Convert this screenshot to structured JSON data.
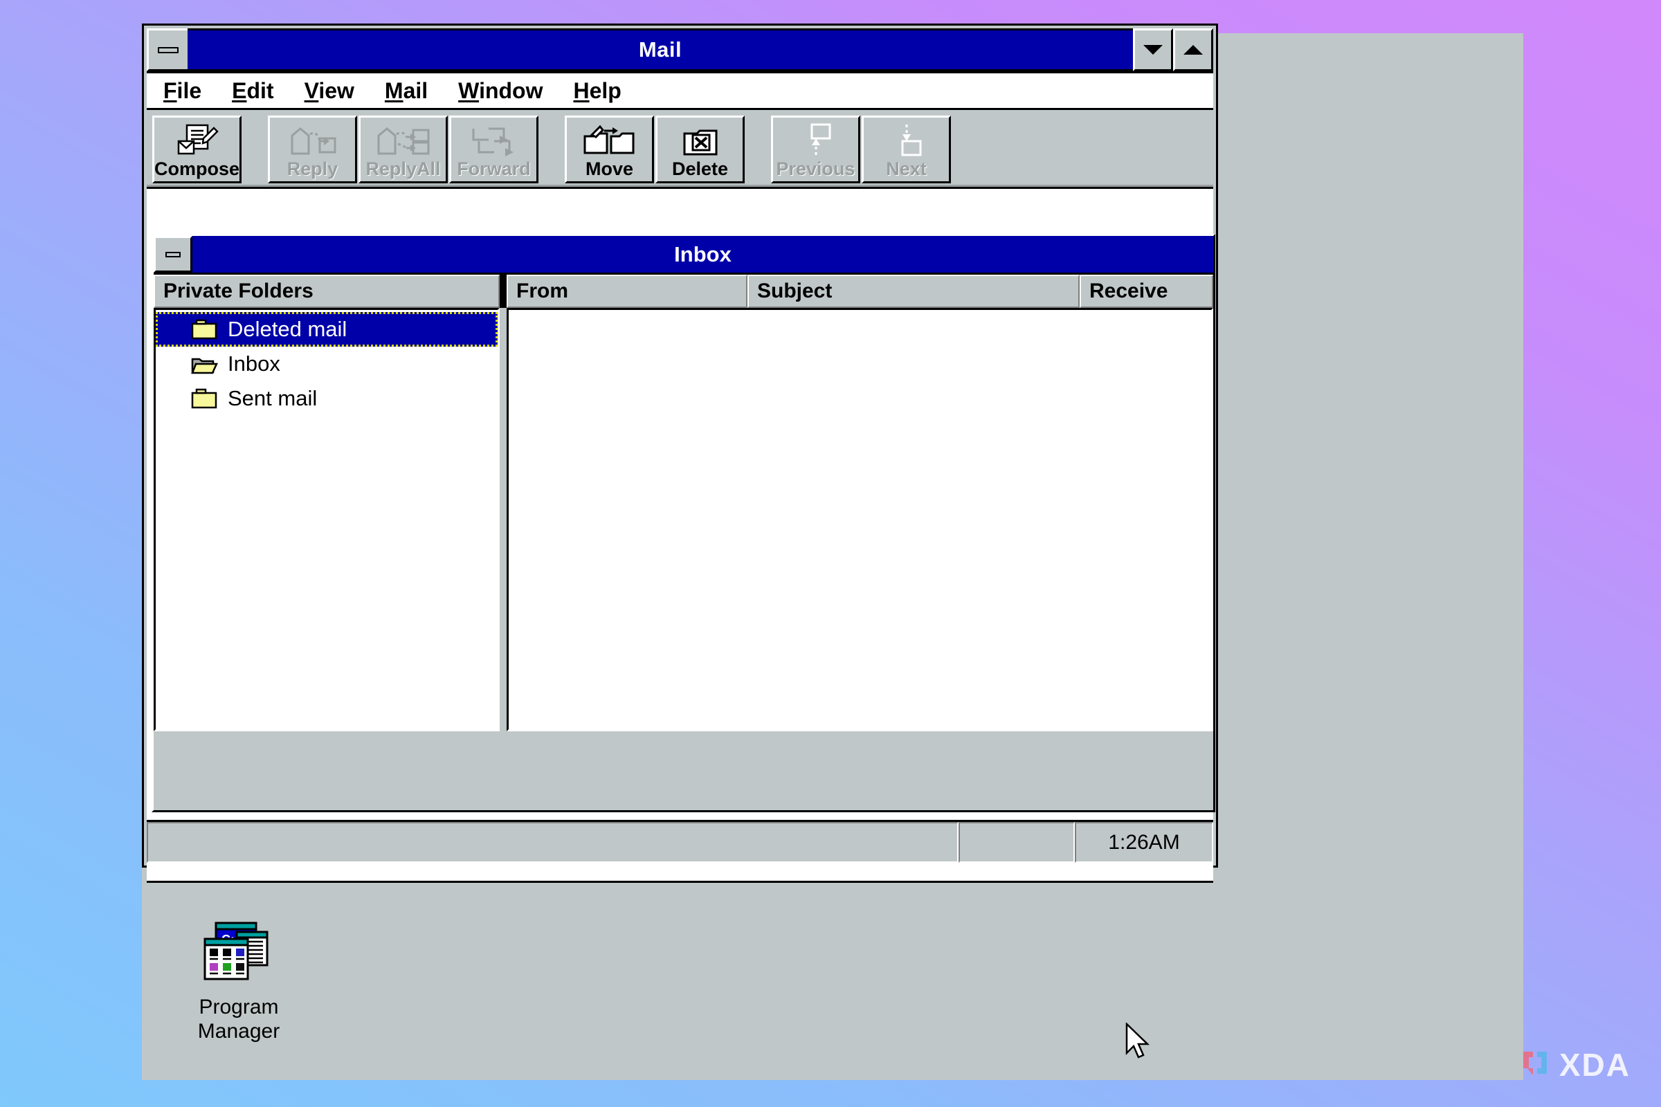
{
  "desktop": {
    "background_gradient_from": "#7fc9fc",
    "background_gradient_to": "#d188fb",
    "desktop_color": "#c0c7c8",
    "icons": [
      {
        "name": "program-manager",
        "label_line1": "Program",
        "label_line2": "Manager"
      }
    ]
  },
  "window": {
    "title": "Mail",
    "titlebar_color": "#0000a8",
    "system_menu": "minimize-bar",
    "buttons": [
      {
        "name": "minimize",
        "glyph": "arrow-down"
      },
      {
        "name": "maximize",
        "glyph": "arrow-up"
      }
    ]
  },
  "menubar": {
    "items": [
      {
        "label": "File",
        "accel": "F"
      },
      {
        "label": "Edit",
        "accel": "E"
      },
      {
        "label": "View",
        "accel": "V"
      },
      {
        "label": "Mail",
        "accel": "M"
      },
      {
        "label": "Window",
        "accel": "W"
      },
      {
        "label": "Help",
        "accel": "H"
      }
    ]
  },
  "toolbar": {
    "buttons": [
      {
        "label": "Compose",
        "icon": "compose-icon",
        "enabled": true
      },
      {
        "label": "Reply",
        "icon": "reply-icon",
        "enabled": false
      },
      {
        "label": "ReplyAll",
        "icon": "replyall-icon",
        "enabled": false
      },
      {
        "label": "Forward",
        "icon": "forward-icon",
        "enabled": false
      },
      {
        "label": "Move",
        "icon": "move-icon",
        "enabled": true
      },
      {
        "label": "Delete",
        "icon": "delete-icon",
        "enabled": true
      },
      {
        "label": "Previous",
        "icon": "previous-icon",
        "enabled": false
      },
      {
        "label": "Next",
        "icon": "next-icon",
        "enabled": false
      }
    ]
  },
  "inbox_window": {
    "title": "Inbox",
    "folder_pane": {
      "header": "Private Folders",
      "folders": [
        {
          "label": "Deleted mail",
          "icon": "folder-closed-icon",
          "selected": true
        },
        {
          "label": "Inbox",
          "icon": "folder-open-icon",
          "selected": false
        },
        {
          "label": "Sent mail",
          "icon": "folder-closed-icon",
          "selected": false
        }
      ]
    },
    "message_list": {
      "columns": [
        "From",
        "Subject",
        "Receive"
      ],
      "rows": []
    }
  },
  "statusbar": {
    "message": "",
    "secondary": "",
    "time": "1:26AM"
  },
  "watermark": {
    "text": "XDA"
  }
}
